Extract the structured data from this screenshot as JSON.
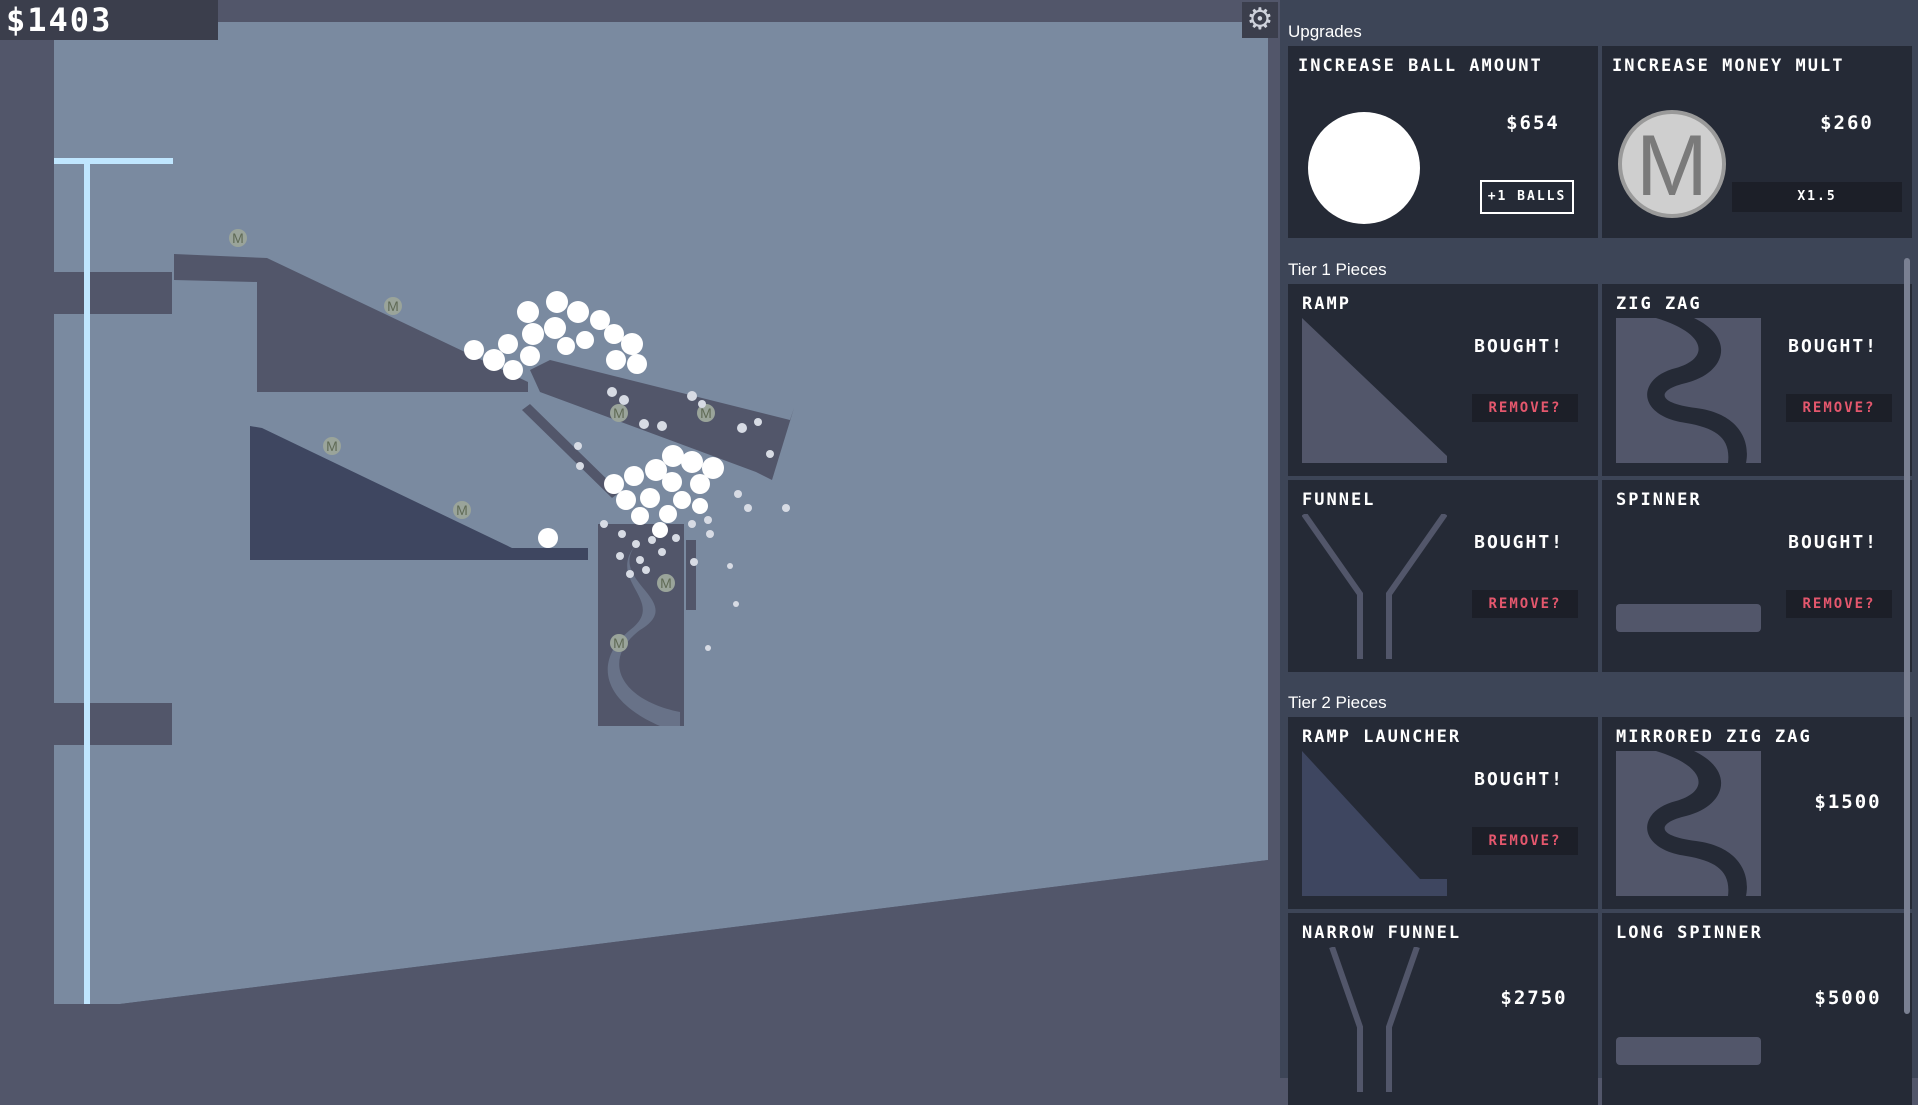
{
  "hud": {
    "money": "$1403",
    "settings_icon": "gear-icon"
  },
  "upgrades": {
    "title": "Upgrades",
    "items": [
      {
        "name": "Increase Ball Amount",
        "price": "$654",
        "action_label": "+1 Balls"
      },
      {
        "name": "Increase Money Mult",
        "price": "$260",
        "multiplier_label": "x1.5",
        "icon_letter": "M"
      }
    ]
  },
  "tier1": {
    "title": "Tier 1 Pieces",
    "pieces": [
      {
        "name": "Ramp",
        "status": "Bought!",
        "remove_label": "Remove?"
      },
      {
        "name": "Zig Zag",
        "status": "Bought!",
        "remove_label": "Remove?"
      },
      {
        "name": "Funnel",
        "status": "Bought!",
        "remove_label": "Remove?"
      },
      {
        "name": "Spinner",
        "status": "Bought!",
        "remove_label": "Remove?"
      }
    ]
  },
  "tier2": {
    "title": "Tier 2 Pieces",
    "pieces": [
      {
        "name": "Ramp Launcher",
        "status": "Bought!",
        "remove_label": "Remove?"
      },
      {
        "name": "Mirrored Zig Zag",
        "price": "$1500"
      },
      {
        "name": "Narrow Funnel",
        "price": "$2750"
      },
      {
        "name": "Long Spinner",
        "price": "$5000"
      }
    ]
  },
  "board": {
    "coin_letter": "M",
    "colors": {
      "wall": "#7a8aa0",
      "floor": "#52566a",
      "piece": "#52566a",
      "piece_dark": "#3e4660",
      "rail": "#bfe6ff",
      "ball": "#ffffff",
      "remove_text": "#e4576d"
    }
  }
}
